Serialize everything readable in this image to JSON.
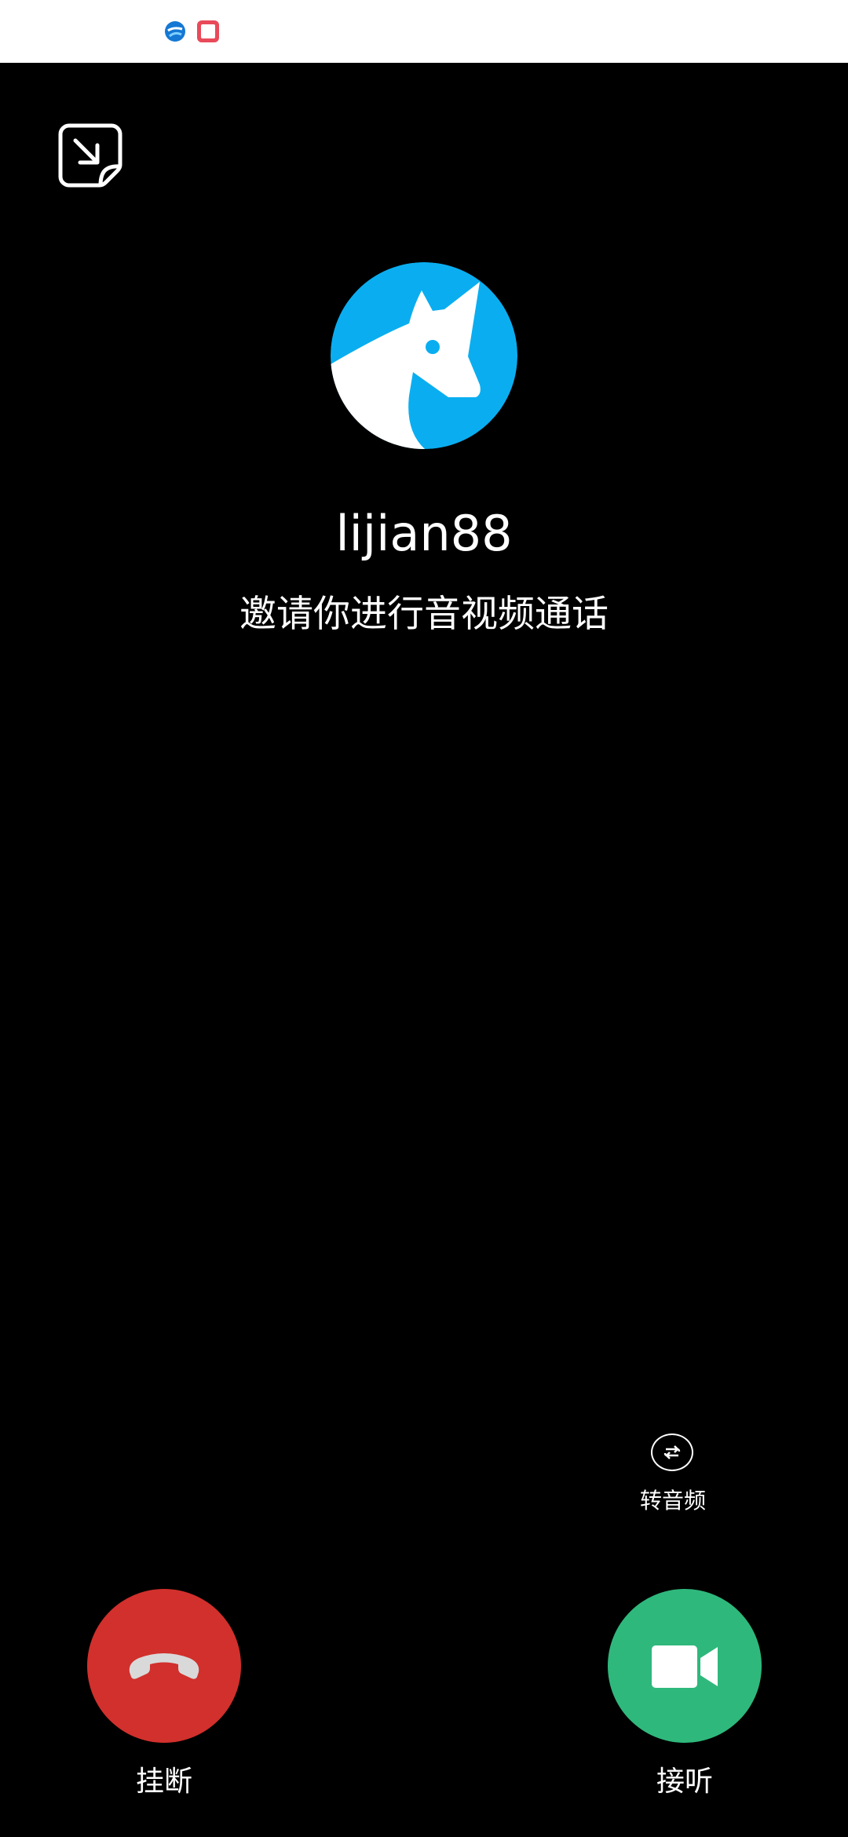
{
  "status_bar": {
    "icons": [
      "browser-app-icon",
      "red-app-icon"
    ]
  },
  "call": {
    "caller_name": "lijian88",
    "invite_text": "邀请你进行音视频通话",
    "avatar_icon": "unicorn-avatar-icon",
    "minimize_icon": "minimize-window-icon"
  },
  "actions": {
    "switch_audio_label": "转音频",
    "hangup_label": "挂断",
    "answer_label": "接听"
  },
  "colors": {
    "background": "#000000",
    "hangup": "#d1302c",
    "answer": "#2fb87c",
    "avatar_blue": "#0aaef0"
  }
}
